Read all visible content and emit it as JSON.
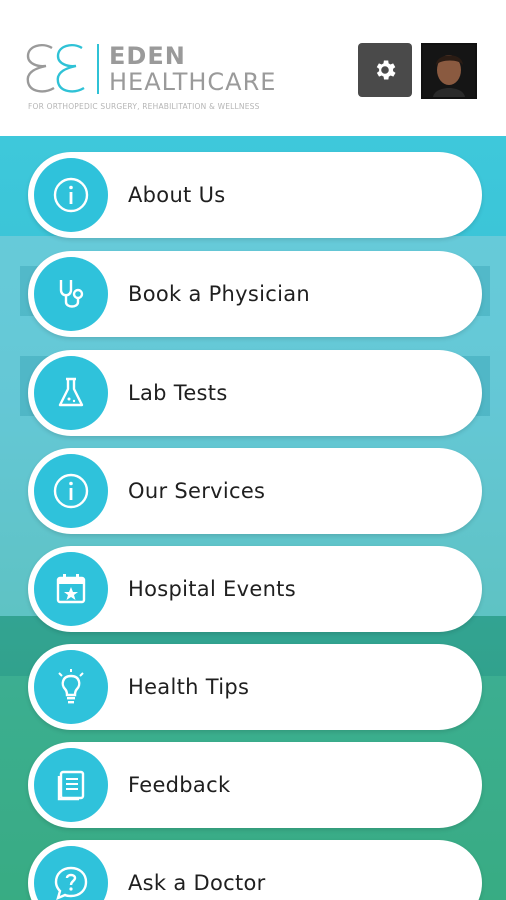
{
  "brand": {
    "name_line1": "EDEN",
    "name_line2": "HEALTHCARE",
    "tagline": "FOR ORTHOPEDIC SURGERY, REHABILITATION & WELLNESS",
    "accent_color": "#2fc2db"
  },
  "header": {
    "settings_icon": "gear-icon",
    "avatar": "profile-avatar"
  },
  "menu": {
    "items": [
      {
        "label": "About Us",
        "icon": "info-icon"
      },
      {
        "label": "Book a Physician",
        "icon": "stethoscope-icon"
      },
      {
        "label": "Lab Tests",
        "icon": "flask-icon"
      },
      {
        "label": "Our Services",
        "icon": "info-icon"
      },
      {
        "label": "Hospital Events",
        "icon": "calendar-star-icon"
      },
      {
        "label": "Health Tips",
        "icon": "lightbulb-icon"
      },
      {
        "label": "Feedback",
        "icon": "document-icon"
      },
      {
        "label": "Ask a Doctor",
        "icon": "question-bubble-icon"
      }
    ]
  }
}
